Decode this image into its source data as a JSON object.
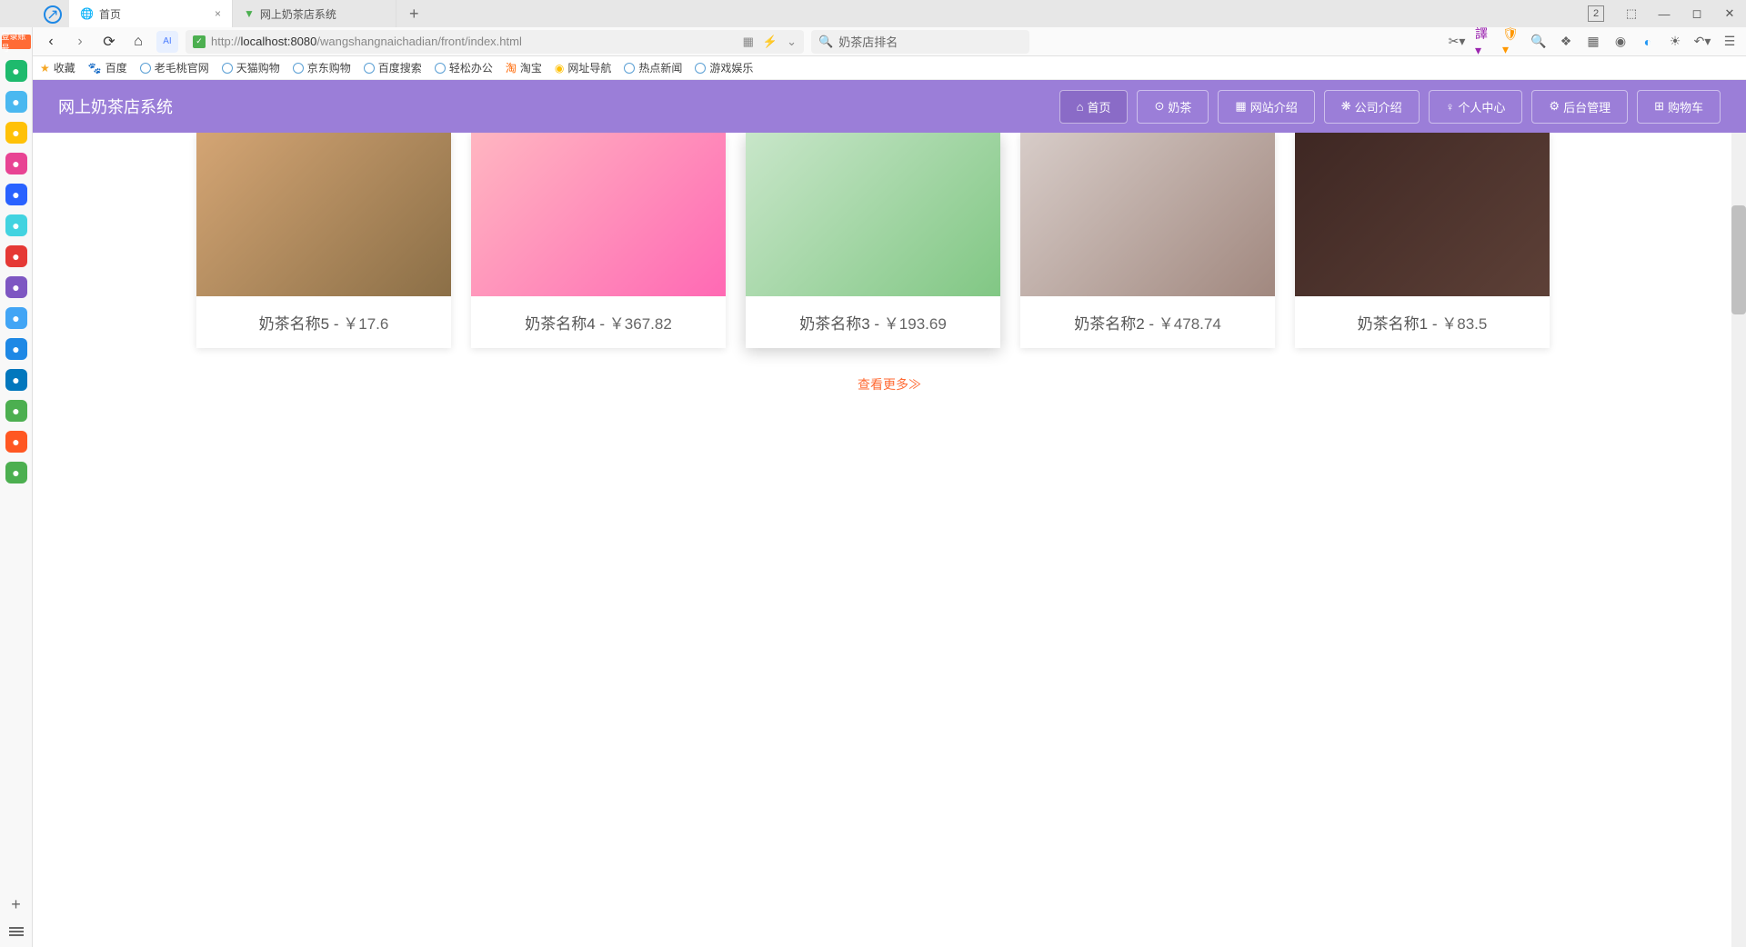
{
  "tabs": [
    {
      "label": "首页",
      "icon": "globe"
    },
    {
      "label": "网上奶茶店系统",
      "icon": "leaf"
    }
  ],
  "window_controls": {
    "count_badge": "2"
  },
  "url": {
    "prefix": "http://",
    "host": "localhost:8080",
    "path": "/wangshangnaichadian/front/index.html"
  },
  "search": {
    "placeholder": "奶茶店排名"
  },
  "bookmarks": [
    {
      "label": "收藏"
    },
    {
      "label": "百度"
    },
    {
      "label": "老毛桃官网"
    },
    {
      "label": "天猫购物"
    },
    {
      "label": "京东购物"
    },
    {
      "label": "百度搜索"
    },
    {
      "label": "轻松办公"
    },
    {
      "label": "淘宝"
    },
    {
      "label": "网址导航"
    },
    {
      "label": "热点新闻"
    },
    {
      "label": "游戏娱乐"
    }
  ],
  "sidebar_badge": "登录账号",
  "sidebar_icons": [
    {
      "name": "compass",
      "color": "#1eba6d"
    },
    {
      "name": "bookmark",
      "color": "#4ab8f0"
    },
    {
      "name": "star",
      "color": "#ffc107"
    },
    {
      "name": "ai",
      "color": "#e84393"
    },
    {
      "name": "al",
      "color": "#2962ff"
    },
    {
      "name": "square",
      "color": "#42d3e0"
    },
    {
      "name": "pdf",
      "color": "#e53935"
    },
    {
      "name": "play",
      "color": "#7e57c2"
    },
    {
      "name": "doc",
      "color": "#42a5f5"
    },
    {
      "name": "msg",
      "color": "#1e88e5"
    },
    {
      "name": "chat",
      "color": "#0277bd"
    },
    {
      "name": "puzzle",
      "color": "#4caf50"
    },
    {
      "name": "weibo",
      "color": "#ff5722"
    },
    {
      "name": "mail",
      "color": "#4caf50"
    }
  ],
  "site": {
    "title": "网上奶茶店系统"
  },
  "nav": [
    {
      "icon": "⌂",
      "label": "首页",
      "active": true
    },
    {
      "icon": "⊙",
      "label": "奶茶"
    },
    {
      "icon": "▦",
      "label": "网站介绍"
    },
    {
      "icon": "❋",
      "label": "公司介绍"
    },
    {
      "icon": "♀",
      "label": "个人中心"
    },
    {
      "icon": "⚙",
      "label": "后台管理"
    },
    {
      "icon": "⊞",
      "label": "购物车"
    }
  ],
  "products": [
    {
      "name": "奶茶名称5",
      "price": "￥17.6",
      "img_class": "img1"
    },
    {
      "name": "奶茶名称4",
      "price": "￥367.82",
      "img_class": "img2"
    },
    {
      "name": "奶茶名称3",
      "price": "￥193.69",
      "img_class": "img3",
      "highlight": true
    },
    {
      "name": "奶茶名称2",
      "price": "￥478.74",
      "img_class": "img4"
    },
    {
      "name": "奶茶名称1",
      "price": "￥83.5",
      "img_class": "img5"
    }
  ],
  "load_more": "查看更多≫"
}
